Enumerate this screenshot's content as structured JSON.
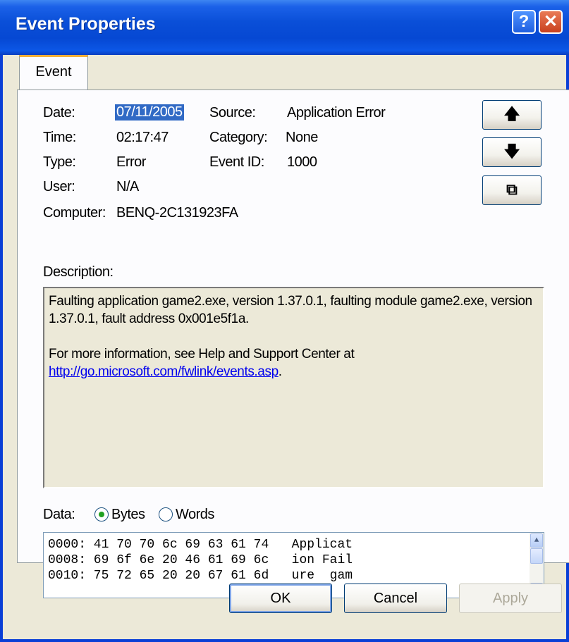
{
  "window": {
    "title": "Event Properties",
    "help_glyph": "?",
    "close_glyph": "✕"
  },
  "tabs": [
    {
      "label": "Event"
    }
  ],
  "fields": {
    "date_label": "Date:",
    "date_value": "07/11/2005",
    "time_label": "Time:",
    "time_value": "02:17:47",
    "type_label": "Type:",
    "type_value": "Error",
    "user_label": "User:",
    "user_value": "N/A",
    "computer_label": "Computer:",
    "computer_value": "BENQ-2C131923FA",
    "source_label": "Source:",
    "source_value": "Application Error",
    "category_label": "Category:",
    "category_value": "None",
    "eventid_label": "Event ID:",
    "eventid_value": "1000"
  },
  "nav": {
    "up_glyph": "🡅",
    "down_glyph": "🡇",
    "copy_glyph": "⧉"
  },
  "description": {
    "label": "Description:",
    "line1": "Faulting application game2.exe, version 1.37.0.1, faulting module game2.exe, version 1.37.0.1, fault address 0x001e5f1a.",
    "line2": "For more information, see Help and Support Center at",
    "link": "http://go.microsoft.com/fwlink/events.asp",
    "link_suffix": "."
  },
  "data": {
    "label": "Data:",
    "bytes_label": "Bytes",
    "words_label": "Words",
    "selected": "Bytes",
    "rows": [
      "0000: 41 70 70 6c 69 63 61 74   Applicat",
      "0008: 69 6f 6e 20 46 61 69 6c   ion Fail",
      "0010: 75 72 65 20 20 67 61 6d   ure  gam"
    ]
  },
  "buttons": {
    "ok": "OK",
    "cancel": "Cancel",
    "apply": "Apply"
  },
  "colors": {
    "title_bar": "#0a4fd8",
    "dialog_bg": "#ece9d8",
    "selection": "#316ac5",
    "link": "#0000ee",
    "tab_accent": "#f5b03a"
  }
}
